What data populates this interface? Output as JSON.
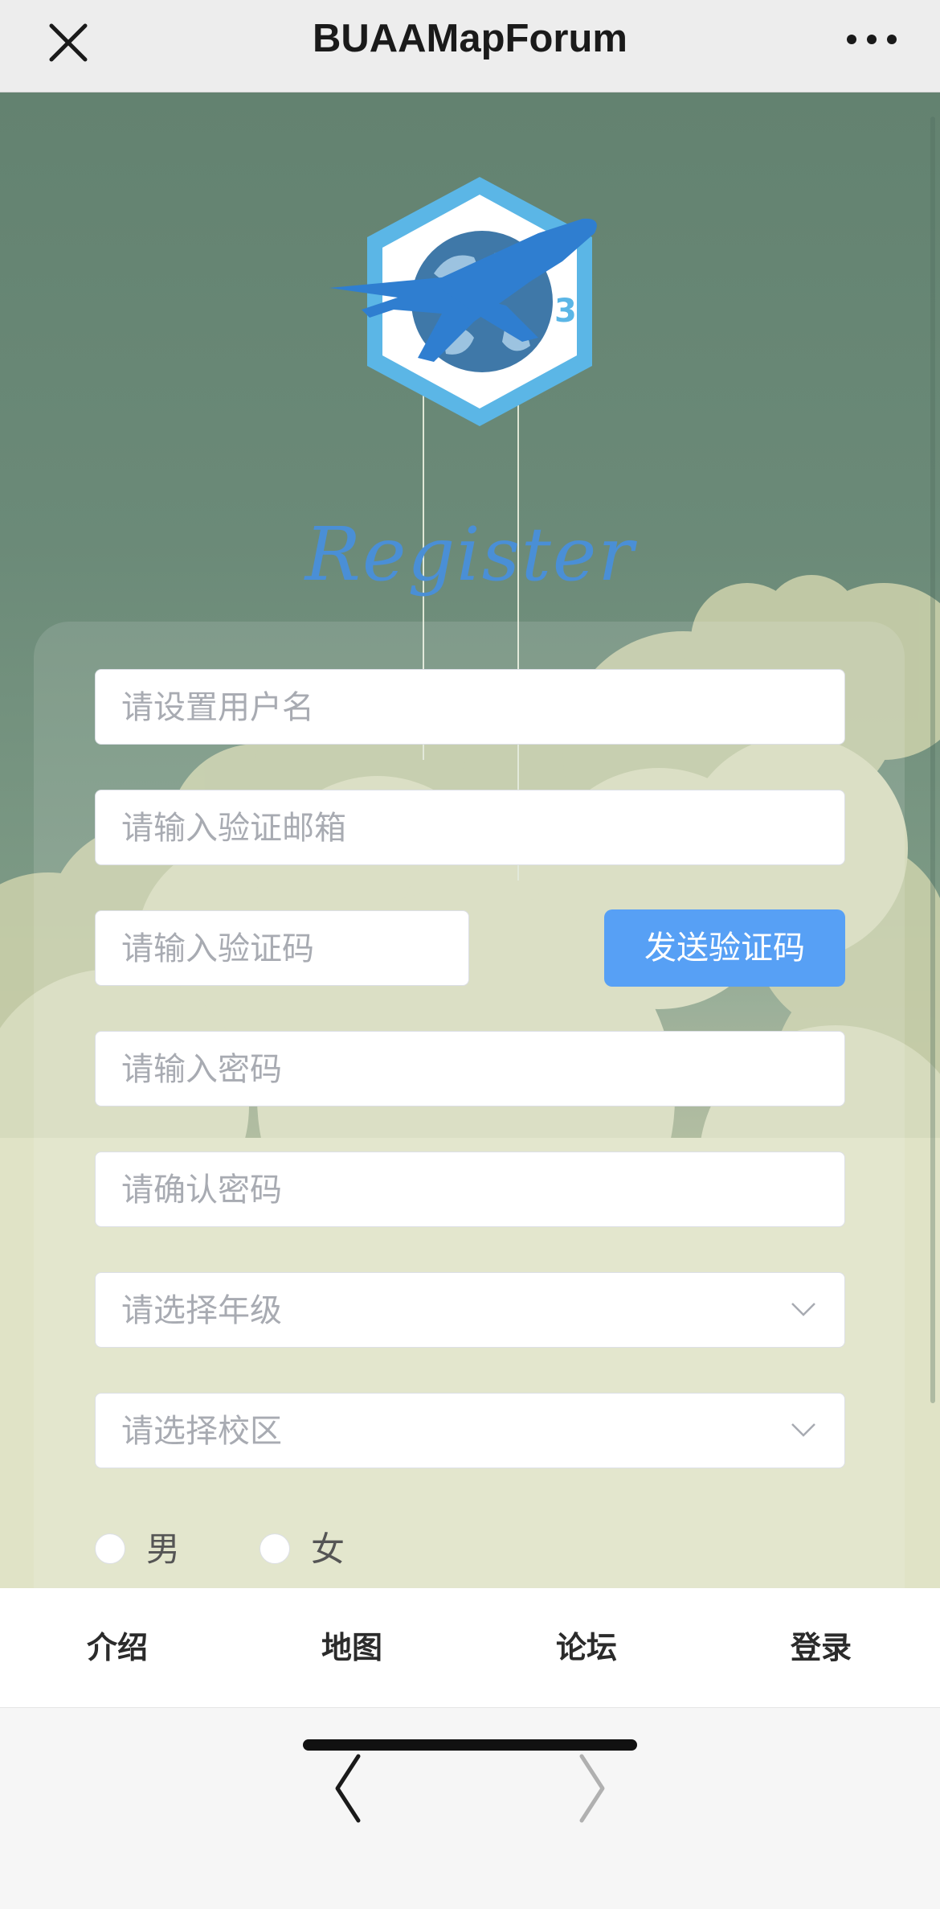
{
  "topbar": {
    "title": "BUAAMapForum",
    "close_icon": "close-icon",
    "more_icon": "more-dots-icon"
  },
  "logo": {
    "icon": "plane-globe-hexagon-logo",
    "colors": {
      "hexagon": "#5bb6e6",
      "plane": "#2f7ed0",
      "globe": "#3f78a8"
    }
  },
  "register": {
    "title": "Register",
    "username_placeholder": "请设置用户名",
    "email_placeholder": "请输入验证邮箱",
    "code_placeholder": "请输入验证码",
    "send_code_label": "发送验证码",
    "password_placeholder": "请输入密码",
    "confirm_placeholder": "请确认密码",
    "grade_placeholder": "请选择年级",
    "campus_placeholder": "请选择校区",
    "gender": {
      "male_label": "男",
      "female_label": "女",
      "selected": null
    }
  },
  "nav": {
    "items": [
      {
        "label": "介绍"
      },
      {
        "label": "地图"
      },
      {
        "label": "论坛"
      },
      {
        "label": "登录"
      }
    ]
  },
  "toolbar": {
    "back_icon": "chevron-left-icon",
    "forward_icon": "chevron-right-icon",
    "forward_enabled": false
  },
  "colors": {
    "accent": "#57a0f5",
    "background_top": "#638270",
    "cloud": "#d8dcc0",
    "title_text": "#4a8fd6"
  }
}
